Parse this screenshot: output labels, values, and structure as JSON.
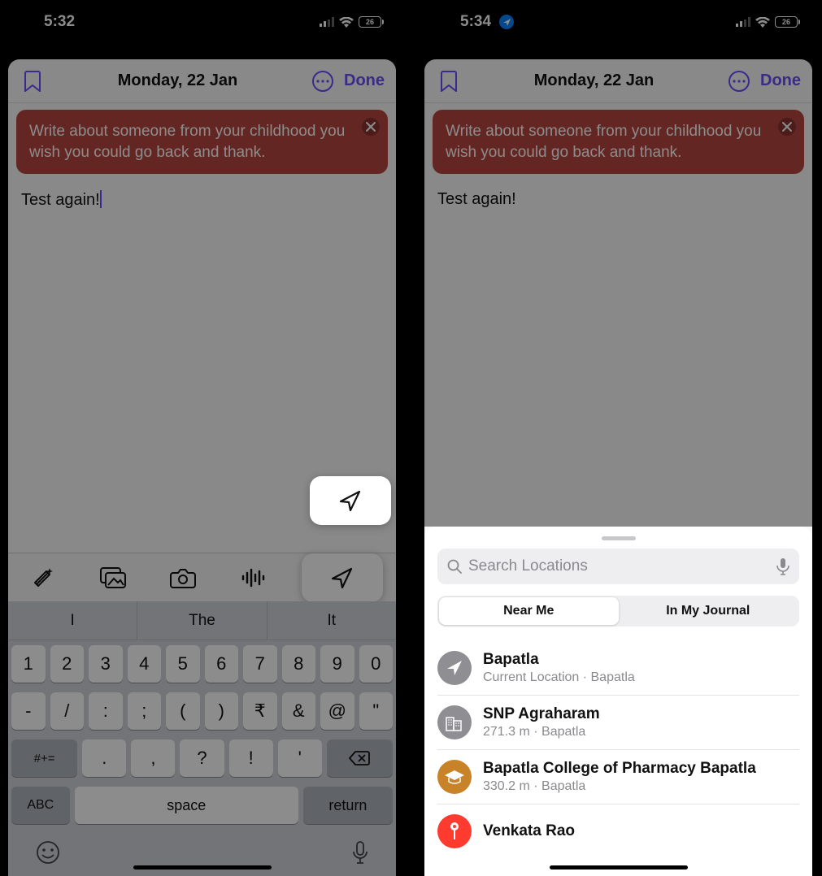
{
  "left": {
    "status": {
      "time": "5:32",
      "battery": "26"
    },
    "header": {
      "date": "Monday, 22 Jan",
      "done": "Done"
    },
    "prompt": "Write about someone from your childhood you wish you could go back and thank.",
    "entry_text": "Test again!",
    "toolbar": {
      "icons": [
        "sparkle",
        "photos",
        "camera",
        "waveform",
        "location"
      ],
      "highlighted": 4
    },
    "keyboard": {
      "suggestions": [
        "I",
        "The",
        "It"
      ],
      "row1": [
        "1",
        "2",
        "3",
        "4",
        "5",
        "6",
        "7",
        "8",
        "9",
        "0"
      ],
      "row2": [
        "-",
        "/",
        ":",
        ";",
        "(",
        ")",
        "₹",
        "&",
        "@",
        "\""
      ],
      "row3_alt": "#+=",
      "row3": [
        ".",
        ",",
        "?",
        "!",
        "'"
      ],
      "bottom": {
        "abc": "ABC",
        "space": "space",
        "return": "return"
      }
    }
  },
  "right": {
    "status": {
      "time": "5:34",
      "battery": "26"
    },
    "header": {
      "date": "Monday, 22 Jan",
      "done": "Done"
    },
    "prompt": "Write about someone from your childhood you wish you could go back and thank.",
    "entry_text": "Test again!",
    "search": {
      "placeholder": "Search Locations"
    },
    "segments": {
      "near": "Near Me",
      "journal": "In My Journal"
    },
    "locations": [
      {
        "name": "Bapatla",
        "sub": "Current Location · Bapatla",
        "icon": "location-arrow",
        "color": "#8e8e93"
      },
      {
        "name": "SNP Agraharam",
        "sub": "271.3 m · Bapatla",
        "icon": "buildings",
        "color": "#8e8e93"
      },
      {
        "name": "Bapatla College of Pharmacy Bapatla",
        "sub": "330.2 m · Bapatla",
        "icon": "graduation",
        "color": "#c88228"
      },
      {
        "name": "Venkata Rao",
        "sub": "",
        "icon": "pin",
        "color": "#ff3b30"
      }
    ]
  }
}
